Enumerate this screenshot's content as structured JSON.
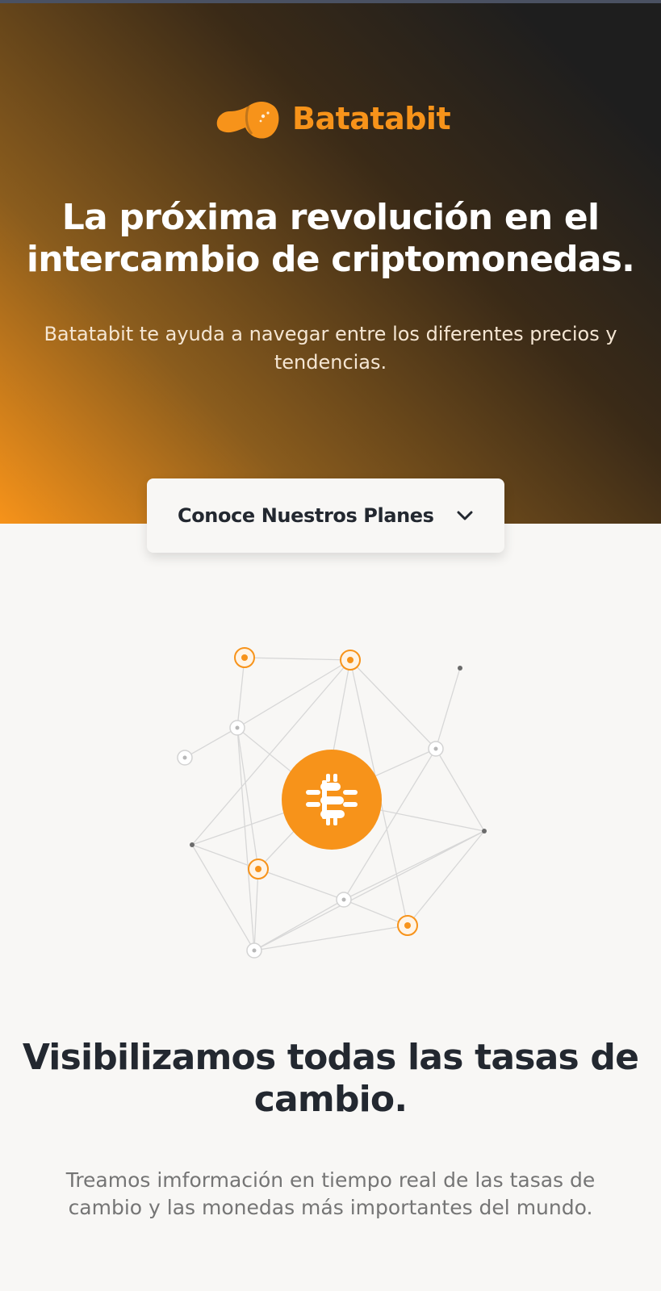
{
  "hero": {
    "brand_name": "Batatabit",
    "title": "La próxima revolución en el intercambio de criptomonedas.",
    "description": "Batatabit te ayuda a navegar entre los diferentes precios y tendencias.",
    "plans_button_label": "Conoce Nuestros Planes",
    "plans_button_icon": "chevron-down-icon"
  },
  "illustration": {
    "center_icon": "bitcoin-icon",
    "background_icon": "network-graph"
  },
  "section": {
    "title": "Visibilizamos todas las tasas de cambio.",
    "description": "Treamos imformación en tiempo real de las tasas de cambio y las monedas más importantes del mundo."
  },
  "colors": {
    "brand_orange": "#f7931a",
    "dark": "#1e1e1e",
    "page_background": "#f8f7f5",
    "heading_text": "#232830",
    "body_text": "#757575"
  }
}
